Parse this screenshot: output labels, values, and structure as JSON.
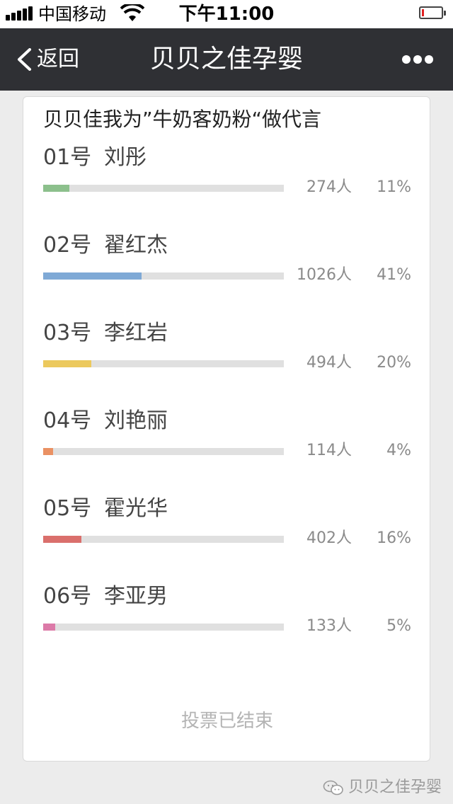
{
  "status_bar": {
    "carrier": "中国移动",
    "time": "下午11:00",
    "battery_level": 0.1
  },
  "nav": {
    "back_label": "返回",
    "title": "贝贝之佳孕婴",
    "more_icon": "more-dots-icon"
  },
  "poll": {
    "title": "贝贝佳我为”牛奶客奶粉“做代言",
    "options": [
      {
        "number": "01号",
        "name": "刘彤",
        "count": "274人",
        "percent": "11%",
        "fraction": 0.11,
        "color": "#8cc08c"
      },
      {
        "number": "02号",
        "name": "翟红杰",
        "count": "1026人",
        "percent": "41%",
        "fraction": 0.41,
        "color": "#7fa9d6"
      },
      {
        "number": "03号",
        "name": "李红岩",
        "count": "494人",
        "percent": "20%",
        "fraction": 0.2,
        "color": "#ecc95d"
      },
      {
        "number": "04号",
        "name": "刘艳丽",
        "count": "114人",
        "percent": "4%",
        "fraction": 0.04,
        "color": "#ea9163"
      },
      {
        "number": "05号",
        "name": "霍光华",
        "count": "402人",
        "percent": "16%",
        "fraction": 0.16,
        "color": "#da6f6c"
      },
      {
        "number": "06号",
        "name": "李亚男",
        "count": "133人",
        "percent": "5%",
        "fraction": 0.05,
        "color": "#dc7aa8"
      }
    ],
    "status": "投票已结束"
  },
  "watermark": {
    "text": "贝贝之佳孕婴",
    "icon": "wechat-icon"
  }
}
